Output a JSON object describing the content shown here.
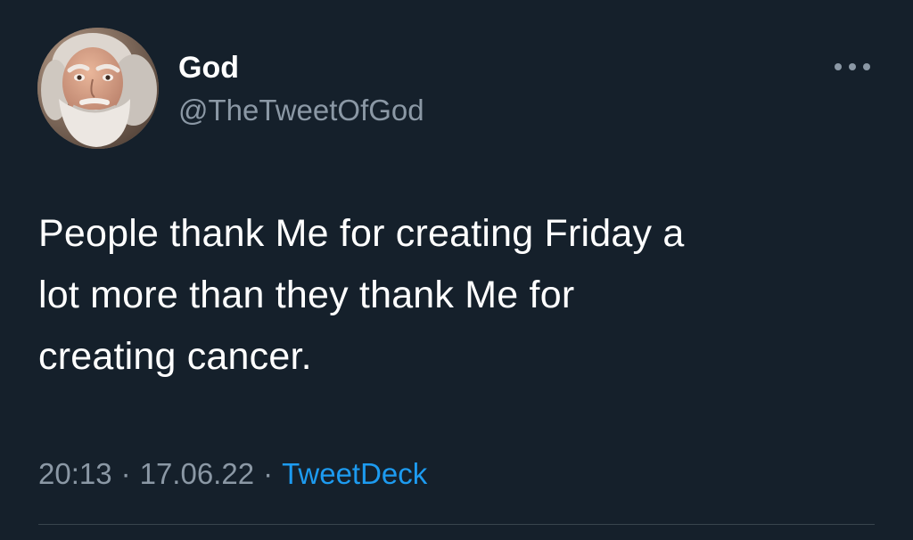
{
  "author": {
    "display_name": "God",
    "handle": "@TheTweetOfGod",
    "avatar_icon": "bearded-man-avatar"
  },
  "more_icon": "more-horizontal-icon",
  "tweet": {
    "text_lines": [
      "People thank Me for creating Friday a",
      "lot more than they thank Me for",
      "creating cancer."
    ]
  },
  "meta": {
    "time": "20:13",
    "separator": "·",
    "date": "17.06.22",
    "source": "TweetDeck"
  },
  "colors": {
    "background": "#15202b",
    "text": "#ffffff",
    "secondary_text": "#8b98a5",
    "link": "#1d9bf0",
    "divider": "#38444d"
  }
}
